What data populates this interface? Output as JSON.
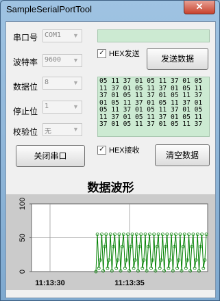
{
  "window": {
    "title": "SampleSerialPortTool",
    "close_glyph": "✕"
  },
  "settings": [
    {
      "label": "串口号",
      "value": "COM1"
    },
    {
      "label": "波特率",
      "value": "9600"
    },
    {
      "label": "数据位",
      "value": "8"
    },
    {
      "label": "停止位",
      "value": "1"
    },
    {
      "label": "校验位",
      "value": "无"
    }
  ],
  "send": {
    "text": "",
    "hex_label": "HEX发送",
    "hex_checked": true,
    "button": "发送数据"
  },
  "receive": {
    "text": "05 11 37 01 05 11 37 01 05 11 37 01 05 11 37 01 05 11 37 01 05 11 37 01 05 11 37 01 05 11 37 01 05 11 37 01 05 11 37 01 05 11 37 01 05 11 37 01 05 11 37 01 05 11 37 01 05 11 37 01 05 11 37",
    "hex_label": "HEX接收",
    "hex_checked": true,
    "button": "清空数据"
  },
  "close_port_button": "关闭串口",
  "chart_title": "数据波形",
  "chart_data": {
    "type": "line",
    "y_ticks": [
      "100",
      "50",
      "0"
    ],
    "ylim": [
      0,
      100
    ],
    "x_ticks": [
      "11:13:30",
      "11:13:35"
    ],
    "series_color": "#008000",
    "values": [
      0,
      55,
      5,
      17,
      55,
      1,
      37,
      55,
      5,
      17,
      55,
      1,
      37,
      55,
      5,
      17,
      55,
      1,
      37,
      55,
      5,
      17,
      55,
      1,
      37,
      55,
      5,
      17,
      55,
      1,
      37,
      55,
      5,
      17,
      55,
      1,
      37,
      55,
      5,
      17,
      55,
      1,
      37,
      55,
      5,
      17,
      55,
      1,
      37,
      55,
      5,
      17,
      55,
      1,
      37,
      55,
      5,
      17,
      55,
      1,
      37,
      55,
      5,
      17,
      55,
      1,
      37,
      55,
      5,
      17,
      55,
      1,
      37,
      55,
      5,
      17,
      55
    ]
  }
}
